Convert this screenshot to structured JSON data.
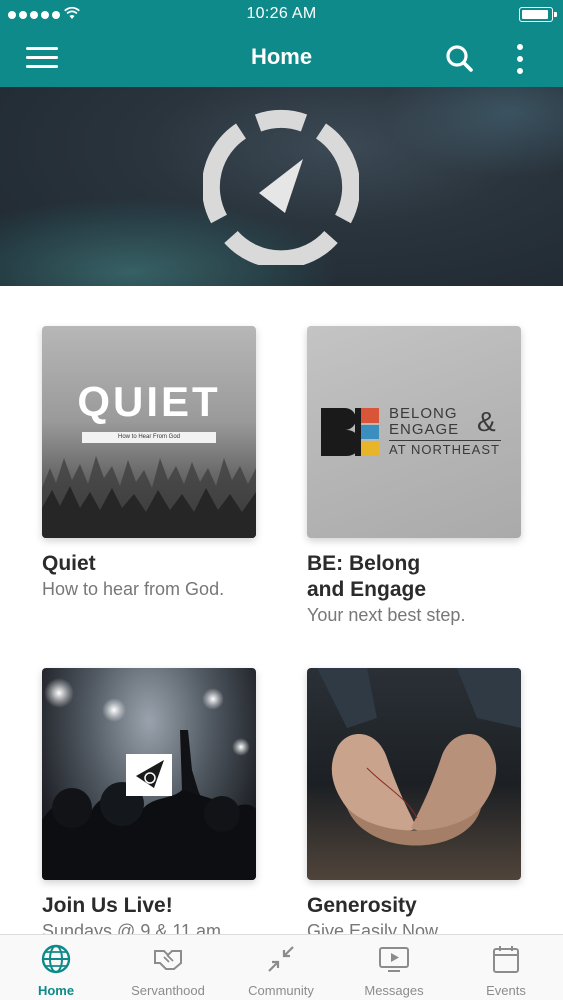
{
  "status_bar": {
    "time": "10:26 AM",
    "battery_level": 0.95
  },
  "nav": {
    "title": "Home"
  },
  "hero": {
    "logo": "compass-logo"
  },
  "cards": [
    {
      "title": "Quiet",
      "subtitle": "How to hear from God.",
      "image_text": "QUIET",
      "image_caption": "How to Hear From God"
    },
    {
      "title": "BE: Belong and Engage",
      "subtitle": "Your next best step.",
      "image_text": [
        "BELONG",
        "ENGAGE",
        "AT NORTHEAST"
      ],
      "image_mark": "BE",
      "image_amp": "&"
    },
    {
      "title": "Join Us Live!",
      "subtitle": "Sundays @ 9 & 11 am"
    },
    {
      "title": "Generosity",
      "subtitle": "Give Easily Now"
    }
  ],
  "tabs": [
    {
      "label": "Home",
      "icon": "globe-icon",
      "active": true
    },
    {
      "label": "Servanthood",
      "icon": "handshake-icon",
      "active": false
    },
    {
      "label": "Community",
      "icon": "arrows-in-icon",
      "active": false
    },
    {
      "label": "Messages",
      "icon": "play-screen-icon",
      "active": false
    },
    {
      "label": "Events",
      "icon": "calendar-icon",
      "active": false
    }
  ],
  "colors": {
    "brand": "#0f8a8a",
    "tab_inactive": "#8c8c8c"
  }
}
